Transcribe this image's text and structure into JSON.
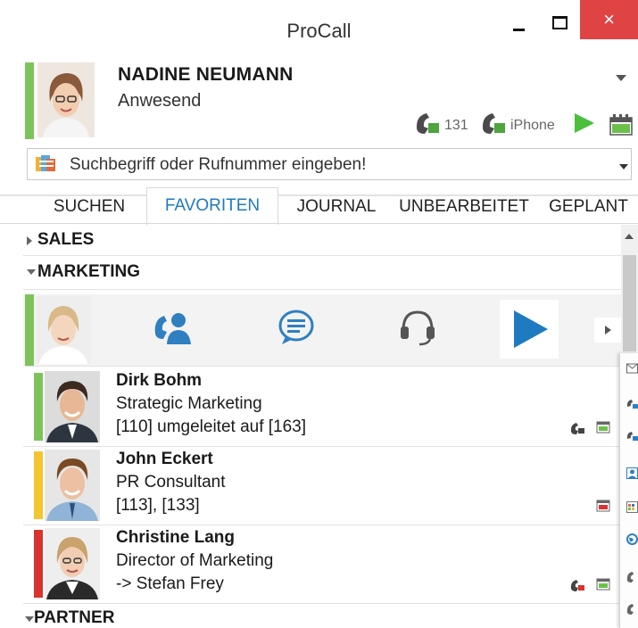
{
  "window": {
    "title": "ProCall",
    "minimize_icon": "minimize-icon",
    "maximize_icon": "maximize-icon",
    "close_glyph": "×",
    "close_color": "#e04343"
  },
  "profile": {
    "name": "NADINE NEUMANN",
    "status": "Anwesend",
    "status_color": "#7dc35b",
    "phones": [
      {
        "label": "131",
        "icon": "phone-icon"
      },
      {
        "label": "iPhone",
        "icon": "phone-icon"
      }
    ],
    "play_icon": "play-icon",
    "calendar_icon": "calendar-icon"
  },
  "search": {
    "placeholder": "Suchbegriff oder Rufnummer eingeben!"
  },
  "tabs": [
    {
      "label": "SUCHEN",
      "active": false
    },
    {
      "label": "FAVORITEN",
      "active": true
    },
    {
      "label": "JOURNAL",
      "active": false
    },
    {
      "label": "UNBEARBEITET",
      "active": false
    },
    {
      "label": "GEPLANT",
      "active": false
    }
  ],
  "accent_color": "#1f7bc1",
  "groups": {
    "sales": "SALES",
    "marketing": "MARKETING",
    "partner": "PARTNER"
  },
  "action_bar": {
    "icons": [
      "call-contact-icon",
      "chat-icon",
      "headset-icon",
      "play-icon",
      "chevron-right-icon"
    ]
  },
  "contacts": [
    {
      "name": "Dirk Bohm",
      "role": "Strategic Marketing",
      "ext": "[110] umgeleitet auf [163]",
      "status_color": "#7dc35b"
    },
    {
      "name": "John Eckert",
      "role": "PR Consultant",
      "ext": "[113], [133]",
      "status_color": "#f5c431"
    },
    {
      "name": "Christine Lang",
      "role": "Director of Marketing",
      "ext": "-> Stefan Frey",
      "status_color": "#d9332f"
    }
  ]
}
